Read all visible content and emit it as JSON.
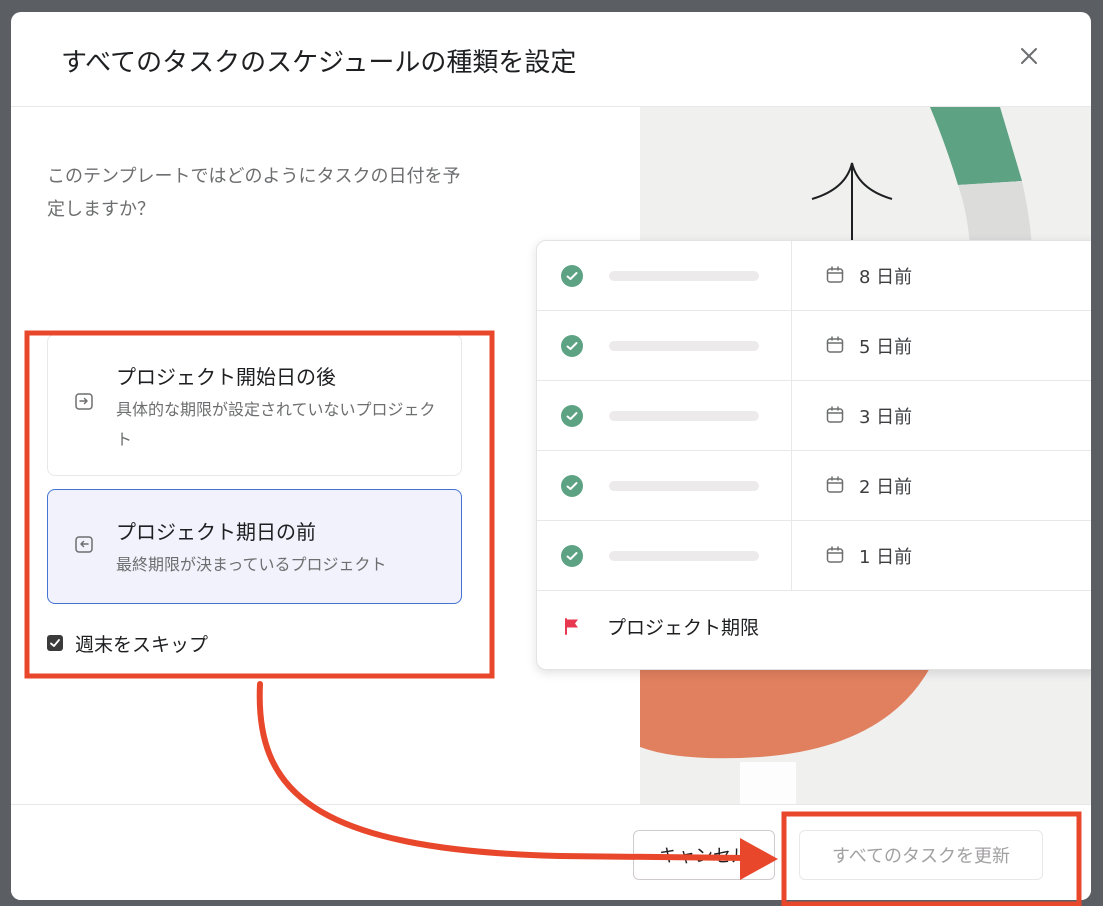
{
  "dialog": {
    "title": "すべてのタスクのスケジュールの種類を設定"
  },
  "question": "このテンプレートではどのようにタスクの日付を予定しますか？",
  "options": [
    {
      "title": "プロジェクト開始日の後",
      "description": "具体的な期限が設定されていないプロジェクト",
      "selected": false
    },
    {
      "title": "プロジェクト期日の前",
      "description": "最終期限が決まっているプロジェクト",
      "selected": true
    }
  ],
  "skip_weekends": {
    "label": "週末をスキップ",
    "checked": true
  },
  "preview": {
    "rows": [
      {
        "date": "8 日前"
      },
      {
        "date": "5 日前"
      },
      {
        "date": "3 日前"
      },
      {
        "date": "2 日前"
      },
      {
        "date": "1 日前"
      }
    ],
    "deadline_label": "プロジェクト期限"
  },
  "footer": {
    "cancel_label": "キャンセル",
    "update_label": "すべてのタスクを更新"
  },
  "colors": {
    "accent_blue": "#4573d2",
    "check_green": "#5da283",
    "annotation_red": "#e8472b",
    "flag_red": "#e8384f"
  }
}
